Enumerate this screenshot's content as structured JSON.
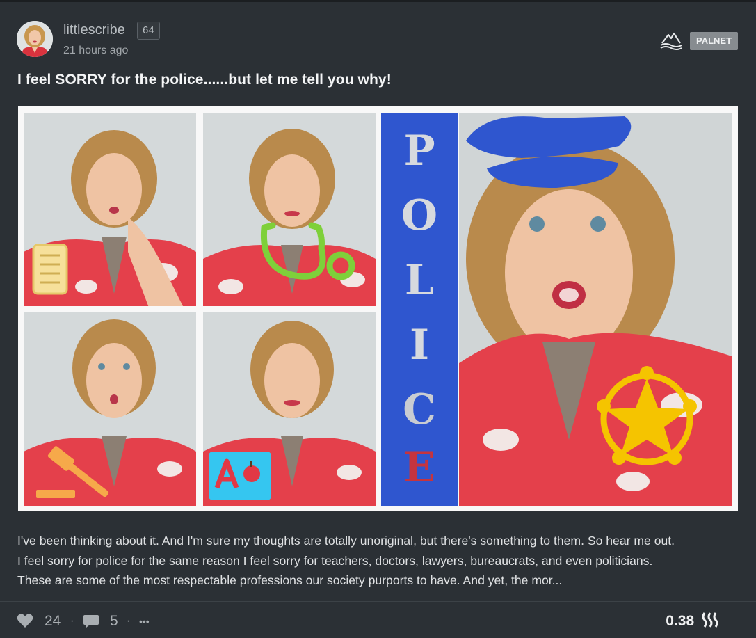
{
  "post": {
    "author": "littlescribe",
    "reputation": "64",
    "time_ago": "21 hours ago",
    "community_tag": "PALNET",
    "title": "I feel SORRY for the police......but let me tell you why!",
    "image": {
      "banner_letters": [
        "P",
        "O",
        "L",
        "I",
        "C",
        "E"
      ]
    },
    "excerpt_lines": [
      "I've been thinking about it. And I'm sure my thoughts are totally unoriginal, but there's something to them. So hear me out.",
      "I feel sorry for police for the same reason I feel sorry for teachers, doctors, lawyers, bureaucrats, and even politicians.",
      "These are some of the most respectable professions our society purports to have. And yet, the mor..."
    ],
    "stats": {
      "likes": "24",
      "comments": "5",
      "more_label": "•••",
      "payout": "0.38"
    },
    "icons": {
      "palnet": "palnet-logo-icon",
      "like": "heart-icon",
      "comment": "comment-icon",
      "more": "ellipsis-icon",
      "currency": "steem-icon"
    },
    "colors": {
      "background": "#2b3035",
      "banner_blue": "#2f56cf",
      "shirt_red": "#e4404b",
      "badge_yellow": "#f5c400"
    }
  }
}
